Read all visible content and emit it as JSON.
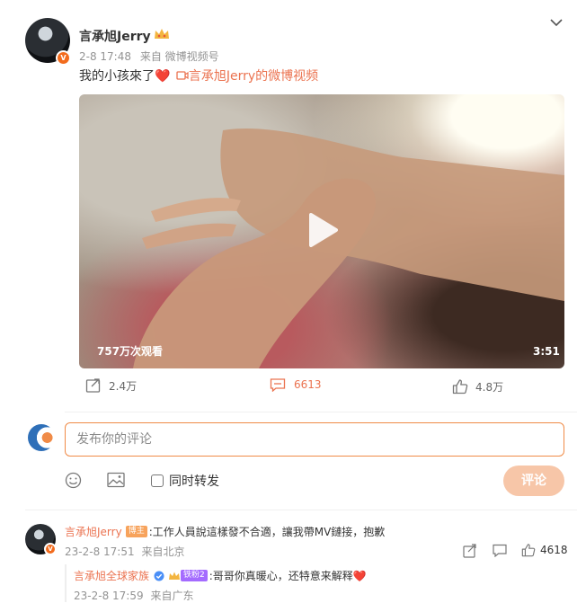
{
  "post": {
    "author": "言承旭Jerry",
    "time": "2-8 17:48",
    "source_prefix": "来自",
    "source": "微博视频号",
    "text": "我的小孩來了",
    "video_link_text": "言承旭Jerry的微博视频",
    "video": {
      "views": "757万次观看",
      "duration": "3:51"
    },
    "stats": {
      "reposts": "2.4万",
      "comments": "6613",
      "likes": "4.8万"
    }
  },
  "composer": {
    "placeholder": "发布你的评论",
    "forward_label": "同时转发",
    "submit_label": "评论"
  },
  "comments": [
    {
      "author": "言承旭Jerry",
      "tag": "博主",
      "text": ":工作人員說這樣發不合適，讓我帶MV鏈接，抱歉",
      "time": "23-2-8 17:51",
      "location": "来自北京",
      "likes": "4618"
    }
  ],
  "reply": {
    "author": "言承旭全球家族",
    "level": "铁粉2",
    "text": ":哥哥你真暖心，还特意来解释",
    "time": "23-2-8 17:59",
    "location": "来自广东"
  },
  "colors": {
    "accent": "#eb7350",
    "verified": "#f26b1d",
    "submit_disabled": "#f7c6a8"
  }
}
